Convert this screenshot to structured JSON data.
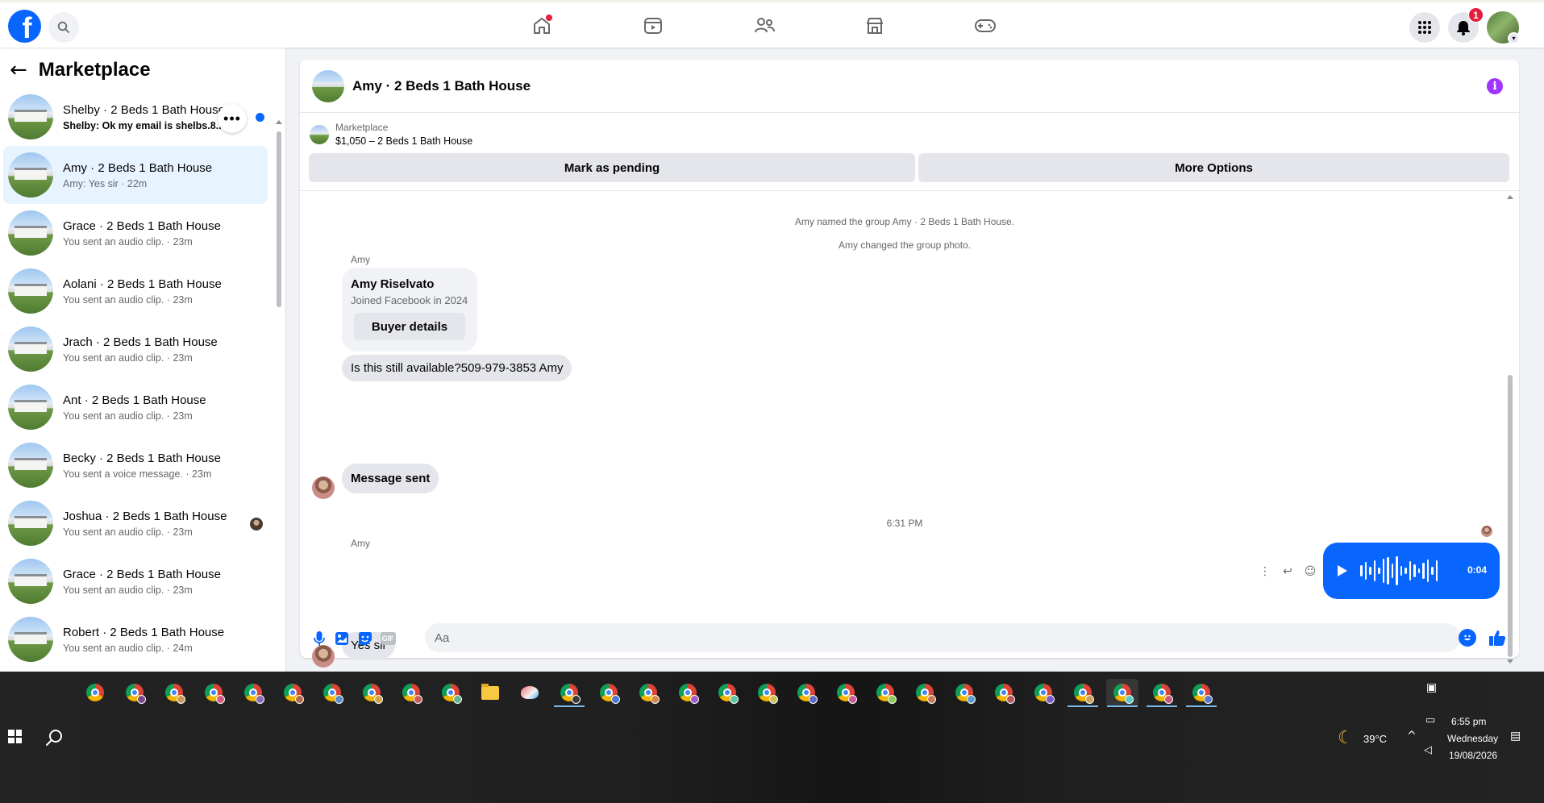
{
  "colors": {
    "brand": "#0866ff",
    "accent_purple": "#a033ff",
    "badge_red": "#e41e3f",
    "active_row": "#e7f3ff"
  },
  "topbar": {
    "logo": "f",
    "icons": [
      "facebook-logo-icon",
      "search-icon",
      "home-icon",
      "video-icon",
      "friends-icon",
      "marketplace-icon",
      "gaming-icon",
      "menu-grid-icon",
      "bell-icon"
    ],
    "notification_count": "1"
  },
  "sidebar": {
    "title": "Marketplace",
    "conversations": [
      {
        "title": "Shelby · 2 Beds 1 Bath House",
        "subtitle": "Shelby: Ok my email is shelbs.8..."
      },
      {
        "title": "Amy · 2 Beds 1 Bath House",
        "subtitle": "Amy: Yes sir · 22m"
      },
      {
        "title": "Grace · 2 Beds 1 Bath House",
        "subtitle": "You sent an audio clip. · 23m"
      },
      {
        "title": "Aolani · 2 Beds 1 Bath House",
        "subtitle": "You sent an audio clip. · 23m"
      },
      {
        "title": "Jrach · 2 Beds 1 Bath House",
        "subtitle": "You sent an audio clip. · 23m"
      },
      {
        "title": "Ant · 2 Beds 1 Bath House",
        "subtitle": "You sent an audio clip. · 23m"
      },
      {
        "title": "Becky · 2 Beds 1 Bath House",
        "subtitle": "You sent a voice message. · 23m"
      },
      {
        "title": "Joshua · 2 Beds 1 Bath House",
        "subtitle": "You sent an audio clip. · 23m"
      },
      {
        "title": "Grace · 2 Beds 1 Bath House",
        "subtitle": "You sent an audio clip. · 23m"
      },
      {
        "title": "Robert · 2 Beds 1 Bath House",
        "subtitle": "You sent an audio clip. · 24m"
      }
    ]
  },
  "chat": {
    "title": "Amy · 2 Beds 1 Bath House",
    "listing_label": "Marketplace",
    "listing_desc": "$1,050 – 2 Beds 1 Bath House",
    "mark_pending": "Mark as pending",
    "more_options": "More Options",
    "system_msgs": [
      "Amy named the group Amy · 2 Beds 1 Bath House.",
      "Amy changed the group photo."
    ],
    "sender": "Amy",
    "buyer_name": "Amy Riselvato",
    "buyer_joined": "Joined Facebook in 2024",
    "buyer_details": "Buyer details",
    "msg_available": "Is this still available?509-979-3853 Amy",
    "msg_sent": "Message sent",
    "timestamp": "6:31 PM",
    "audio_duration": "0:04",
    "msg_yes": "Yes sir",
    "composer_placeholder": "Aa",
    "composer_gif": "GIF"
  },
  "taskbar": {
    "weather_temp": "39°C",
    "time": "6:55 pm",
    "day": "Wednesday",
    "date": "19/08/2026"
  }
}
